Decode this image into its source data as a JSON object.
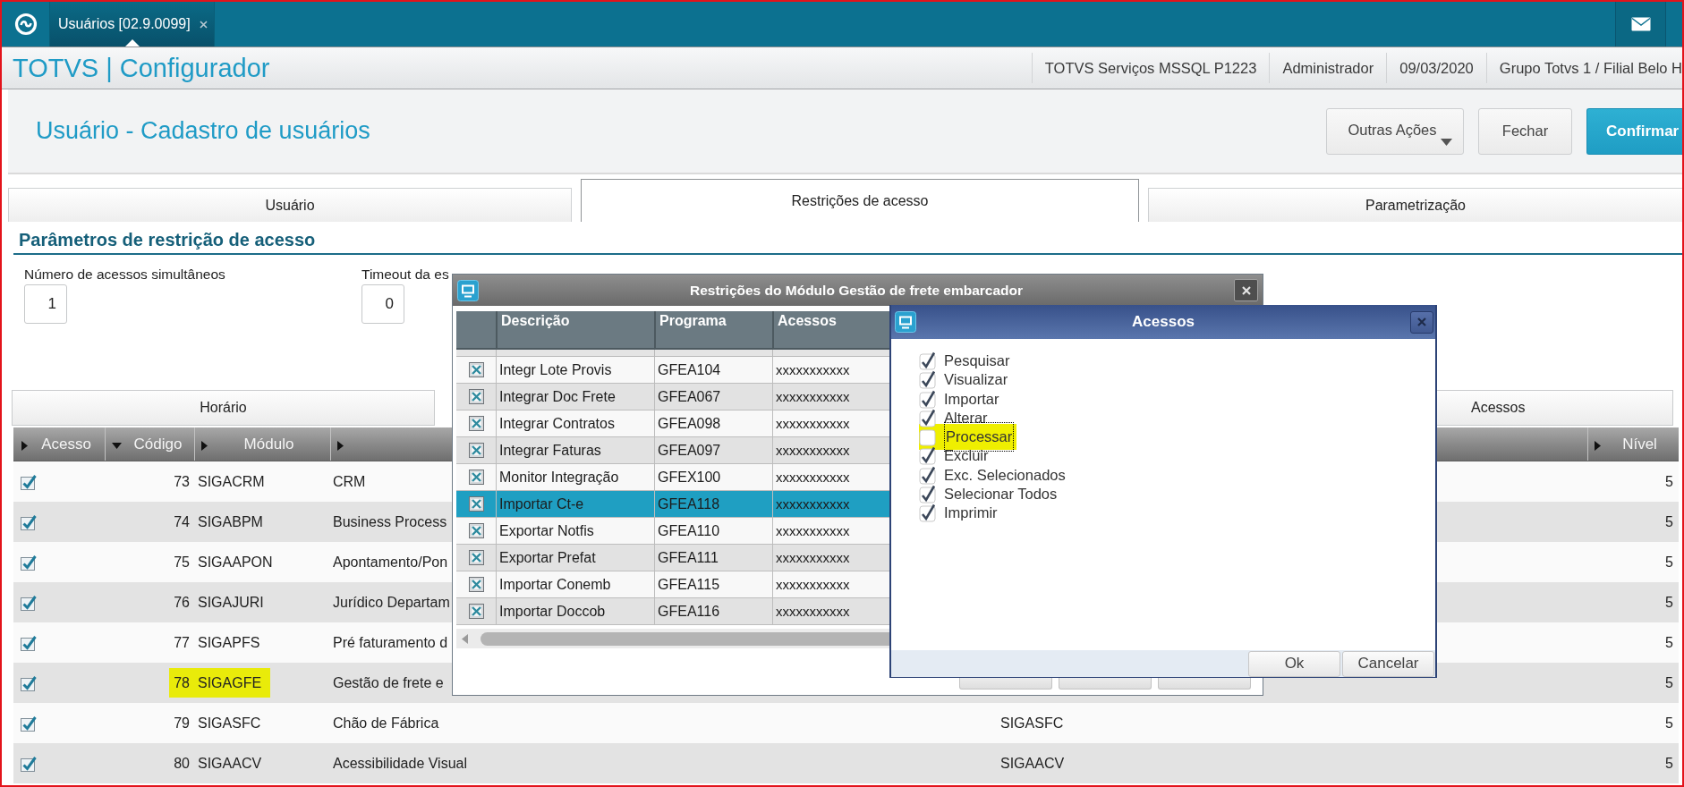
{
  "top_bar": {
    "tab": {
      "label": "Usuários [02.9.0099]",
      "selected": true
    }
  },
  "app_header": {
    "title": "TOTVS | Configurador",
    "info": [
      "TOTVS Serviços MSSQL P1223",
      "Administrador",
      "09/03/2020",
      "Grupo Totvs 1 / Filial Belo H"
    ]
  },
  "page": {
    "title": "Usuário - Cadastro de usuários",
    "actions": [
      {
        "label": "Outras Ações",
        "kind": "menu"
      },
      {
        "label": "Fechar",
        "kind": "default"
      },
      {
        "label": "Confirmar",
        "kind": "primary"
      }
    ]
  },
  "tabs": [
    {
      "label": "Usuário",
      "selected": false
    },
    {
      "label": "Restrições de acesso",
      "selected": true
    },
    {
      "label": "Parametrização",
      "selected": false
    }
  ],
  "section": {
    "title": "Parâmetros de restrição de acesso",
    "fields": [
      {
        "label": "Número de acessos simultâneos",
        "value": "1"
      },
      {
        "label": "Timeout da es",
        "value": "0"
      }
    ]
  },
  "subtabs": [
    {
      "label": "Horário"
    },
    {
      "label": "Acessos"
    }
  ],
  "modules_table": {
    "columns": [
      {
        "label": "Acesso",
        "sorted": false
      },
      {
        "label": "Código",
        "sorted": true
      },
      {
        "label": "Módulo",
        "sorted": false
      },
      {
        "sorted": false
      },
      {
        "label": "Nível",
        "sorted": false
      }
    ],
    "rows": [
      {
        "checked": true,
        "code": "73",
        "module": "SIGACRM",
        "description": "CRM",
        "nivel": "5",
        "highlighted": false
      },
      {
        "checked": true,
        "code": "74",
        "module": "SIGABPM",
        "description": "Business Process",
        "nivel": "5",
        "highlighted": false
      },
      {
        "checked": true,
        "code": "75",
        "module": "SIGAAPON",
        "description": "Apontamento/Pon",
        "nivel": "5",
        "highlighted": false
      },
      {
        "checked": true,
        "code": "76",
        "module": "SIGAJURI",
        "description": "Jurídico Departam",
        "nivel": "5",
        "highlighted": false
      },
      {
        "checked": true,
        "code": "77",
        "module": "SIGAPFS",
        "description": "Pré faturamento d",
        "nivel": "5",
        "highlighted": false
      },
      {
        "checked": true,
        "code": "78",
        "module": "SIGAGFE",
        "description": "Gestão de frete e",
        "nivel": "5",
        "highlighted": true
      },
      {
        "checked": true,
        "code": "79",
        "module": "SIGASFC",
        "description": "Chão de Fábrica",
        "column_5": "SIGASFC",
        "nivel": "5",
        "highlighted": false
      },
      {
        "checked": true,
        "code": "80",
        "module": "SIGAACV",
        "description": "Acessibilidade Visual",
        "column_5": "SIGAACV",
        "nivel": "5",
        "highlighted": false
      }
    ]
  },
  "restrictions_dialog": {
    "title": "Restrições do Módulo Gestão de frete embarcador",
    "columns": [
      "Descrição",
      "Programa",
      "Acessos"
    ],
    "rows": [
      {
        "checked": true,
        "description": "Integr Lote Provis",
        "program": "GFEA104",
        "access": "xxxxxxxxxxx",
        "selected": false
      },
      {
        "checked": true,
        "description": "Integrar Doc Frete",
        "program": "GFEA067",
        "access": "xxxxxxxxxxx",
        "selected": false
      },
      {
        "checked": true,
        "description": "Integrar Contratos",
        "program": "GFEA098",
        "access": "xxxxxxxxxxx",
        "selected": false
      },
      {
        "checked": true,
        "description": "Integrar Faturas",
        "program": "GFEA097",
        "access": "xxxxxxxxxxx",
        "selected": false
      },
      {
        "checked": true,
        "description": "Monitor Integração",
        "program": "GFEX100",
        "access": "xxxxxxxxxxx",
        "selected": false
      },
      {
        "checked": true,
        "description": "Importar Ct-e",
        "program": "GFEA118",
        "access": "xxxxxxxxxxx",
        "selected": true
      },
      {
        "checked": true,
        "description": "Exportar Notfis",
        "program": "GFEA110",
        "access": "xxxxxxxxxxx",
        "selected": false
      },
      {
        "checked": true,
        "description": "Exportar Prefat",
        "program": "GFEA111",
        "access": "xxxxxxxxxxx",
        "selected": false
      },
      {
        "checked": true,
        "description": "Importar Conemb",
        "program": "GFEA115",
        "access": "xxxxxxxxxxx",
        "selected": false
      },
      {
        "checked": true,
        "description": "Importar Doccob",
        "program": "GFEA116",
        "access": "xxxxxxxxxxx",
        "selected": false
      }
    ],
    "footer_buttons": [
      {
        "kind": "covered"
      },
      {
        "kind": "covered"
      },
      {
        "kind": "covered"
      }
    ]
  },
  "access_dialog": {
    "title": "Acessos",
    "options": [
      {
        "label": "Pesquisar",
        "checked": true,
        "highlighted": false,
        "focused": false
      },
      {
        "label": "Visualizar",
        "checked": true,
        "highlighted": false,
        "focused": false
      },
      {
        "label": "Importar",
        "checked": true,
        "highlighted": false,
        "focused": false
      },
      {
        "label": "Alterar",
        "checked": true,
        "highlighted": false,
        "focused": false
      },
      {
        "label": "Processar",
        "checked": false,
        "highlighted": true,
        "focused": true
      },
      {
        "label": "Excluir",
        "checked": true,
        "highlighted": false,
        "focused": false
      },
      {
        "label": "Exc. Selecionados",
        "checked": true,
        "highlighted": false,
        "focused": false
      },
      {
        "label": "Selecionar Todos",
        "checked": true,
        "highlighted": false,
        "focused": false
      },
      {
        "label": "Imprimir",
        "checked": true,
        "highlighted": false,
        "focused": false
      }
    ],
    "buttons": [
      "Ok",
      "Cancelar"
    ]
  }
}
